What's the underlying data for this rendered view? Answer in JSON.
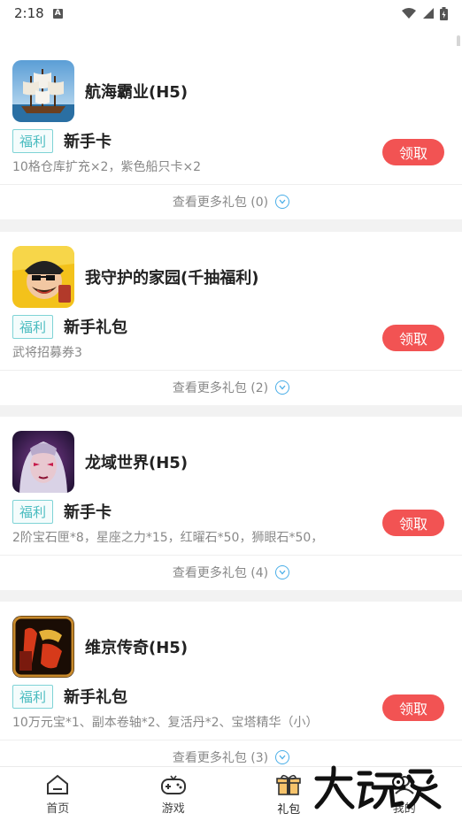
{
  "status_bar": {
    "time": "2:18",
    "notification_icon": "a-badge-icon",
    "icons": [
      "wifi-icon",
      "signal-icon",
      "battery-charging-icon"
    ]
  },
  "colors": {
    "claim_button": "#f25353",
    "badge_border": "#7fd3d6",
    "badge_text": "#4bbcc0",
    "more_chevron": "#4aaee8",
    "background": "#f2f2f2"
  },
  "cards": [
    {
      "game_name": "航海霸业(H5)",
      "icon": "sailing-ship-icon",
      "badge": "福利",
      "gift_title": "新手卡",
      "gift_desc": "10格仓库扩充×2，紫色船只卡×2",
      "claim_label": "领取",
      "more_label": "查看更多礼包 (0)"
    },
    {
      "game_name": "我守护的家园(千抽福利)",
      "icon": "cartoon-warrior-icon",
      "badge": "福利",
      "gift_title": "新手礼包",
      "gift_desc": "武将招募券3",
      "claim_label": "领取",
      "more_label": "查看更多礼包 (2)"
    },
    {
      "game_name": "龙域世界(H5)",
      "icon": "dark-sorceress-icon",
      "badge": "福利",
      "gift_title": "新手卡",
      "gift_desc": "2阶宝石匣*8，星座之力*15，红曜石*50，狮眼石*50，",
      "claim_label": "领取",
      "more_label": "查看更多礼包 (4)"
    },
    {
      "game_name": "维京传奇(H5)",
      "icon": "legend-calligraphy-icon",
      "badge": "福利",
      "gift_title": "新手礼包",
      "gift_desc": "10万元宝*1、副本卷轴*2、复活丹*2、宝塔精华（小）",
      "claim_label": "领取",
      "more_label": "查看更多礼包 (3)"
    }
  ],
  "bottom_nav": [
    {
      "label": "首页",
      "icon": "home-icon"
    },
    {
      "label": "游戏",
      "icon": "gamepad-icon"
    },
    {
      "label": "礼包",
      "icon": "gift-icon",
      "active": true
    },
    {
      "label": "我的",
      "icon": "profile-icon"
    }
  ],
  "watermark": {
    "text": "大玩家",
    "icon": "dawanjia-logo"
  }
}
